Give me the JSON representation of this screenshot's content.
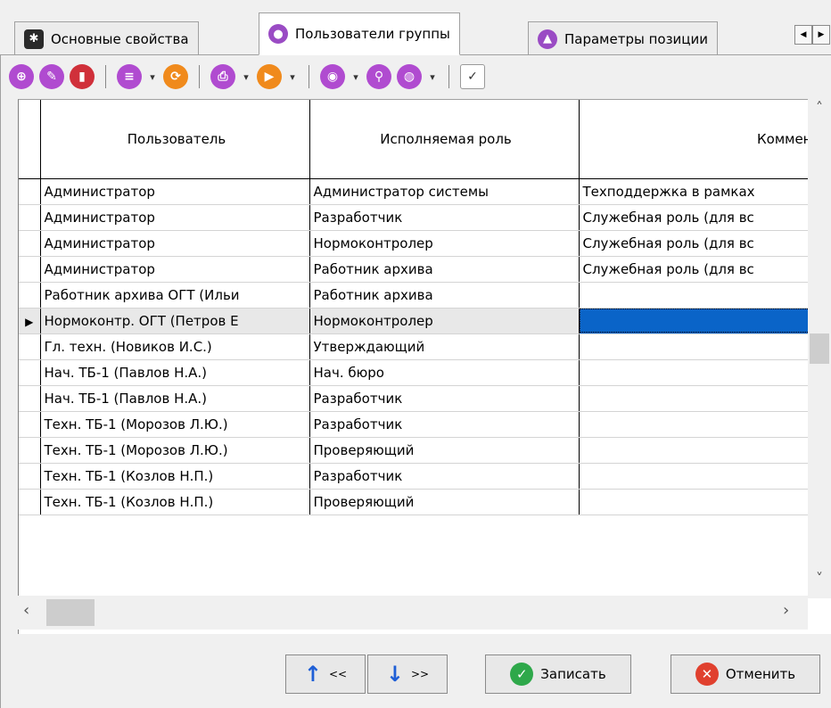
{
  "tabs": [
    {
      "label": "Основные свойства",
      "icon": "group-properties-icon",
      "color": "#2a2a2a"
    },
    {
      "label": "Пользователи группы",
      "icon": "user-icon",
      "color": "#9a4bc4"
    },
    {
      "label": "Параметры позиции",
      "icon": "position-params-icon",
      "color": "#9a4bc4"
    }
  ],
  "toolbar": {
    "buttons": [
      {
        "name": "add-icon",
        "color": "#b04bd0",
        "glyph": "+"
      },
      {
        "name": "edit-icon",
        "color": "#b04bd0",
        "glyph": "✎"
      },
      {
        "name": "delete-icon",
        "color": "#d0303a",
        "glyph": "▮"
      },
      {
        "name": "list-icon",
        "color": "#b04bd0",
        "glyph": "≡"
      },
      {
        "name": "refresh-icon",
        "color": "#f08a1c",
        "glyph": "⟳"
      },
      {
        "name": "print-icon",
        "color": "#b04bd0",
        "glyph": "⎙"
      },
      {
        "name": "run-icon",
        "color": "#f08a1c",
        "glyph": "▶"
      },
      {
        "name": "view-icon",
        "color": "#b04bd0",
        "glyph": "◉"
      },
      {
        "name": "find-icon",
        "color": "#b04bd0",
        "glyph": "⚲"
      },
      {
        "name": "globe-icon",
        "color": "#b04bd0",
        "glyph": "◍"
      },
      {
        "name": "select-columns-icon",
        "color": "#444444",
        "glyph": "✓"
      }
    ]
  },
  "grid": {
    "columns": [
      "Пользователь",
      "Исполняемая роль",
      "Коммен"
    ],
    "rows": [
      [
        "Администратор",
        "Администратор системы",
        "Техподдержка в рамках"
      ],
      [
        "Администратор",
        "Разработчик",
        "Служебная роль (для вс"
      ],
      [
        "Администратор",
        "Нормоконтролер",
        "Служебная роль (для вс"
      ],
      [
        "Администратор",
        "Работник архива",
        "Служебная роль (для вс"
      ],
      [
        "Работник архива ОГТ (Ильи",
        "Работник архива",
        ""
      ],
      [
        "Нормоконтр. ОГТ (Петров Е",
        "Нормоконтролер",
        ""
      ],
      [
        "Гл. техн. (Новиков И.С.)",
        "Утверждающий",
        ""
      ],
      [
        "Нач. ТБ-1 (Павлов Н.А.)",
        "Нач. бюро",
        ""
      ],
      [
        "Нач. ТБ-1 (Павлов Н.А.)",
        "Разработчик",
        ""
      ],
      [
        "Техн. ТБ-1 (Морозов Л.Ю.)",
        "Разработчик",
        ""
      ],
      [
        "Техн. ТБ-1 (Морозов Л.Ю.)",
        "Проверяющий",
        ""
      ],
      [
        "Техн. ТБ-1 (Козлов Н.П.)",
        "Разработчик",
        ""
      ],
      [
        "Техн. ТБ-1 (Козлов Н.П.)",
        "Проверяющий",
        ""
      ]
    ],
    "selected_row": 5
  },
  "buttons": {
    "prev_label": "<<",
    "next_label": ">>",
    "save_label": "Записать",
    "cancel_label": "Отменить",
    "save_color": "#2ea84a",
    "cancel_color": "#e0402e"
  }
}
